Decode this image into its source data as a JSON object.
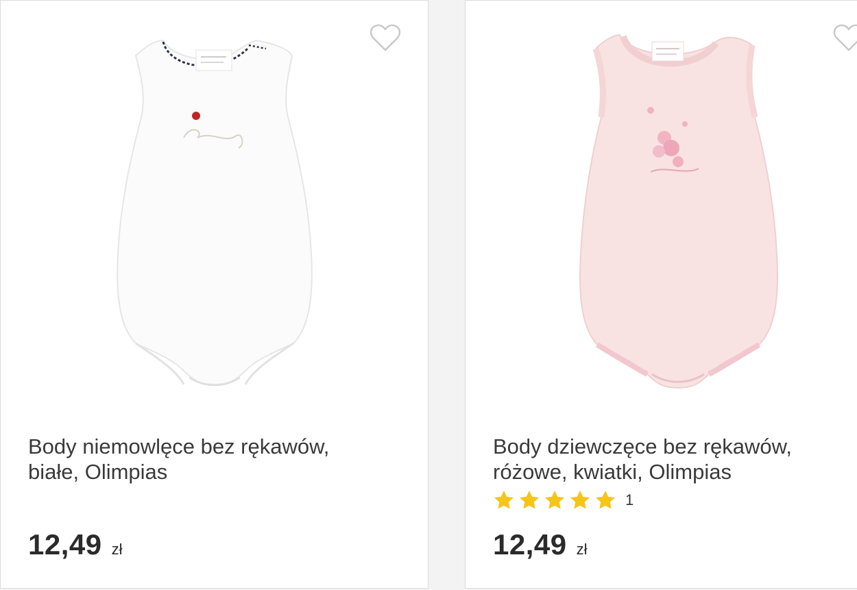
{
  "products": [
    {
      "title_line1": "Body niemowlęce bez rękawów,",
      "title_line2": "białe, Olimpias",
      "price": "12,49",
      "currency": "zł",
      "image_color": "#ffffff"
    },
    {
      "title_line1": "Body dziewczęce bez rękawów,",
      "title_line2": "różowe, kwiatki, Olimpias",
      "rating": 5,
      "rating_count": "1",
      "price": "12,49",
      "currency": "zł",
      "image_color": "#f8e2e2"
    }
  ],
  "colors": {
    "star": "#f5c518",
    "heart_outline": "#c8c8c8",
    "text": "#3a3a3a"
  },
  "icons": [
    "heart-outline-icon",
    "star-icon"
  ]
}
